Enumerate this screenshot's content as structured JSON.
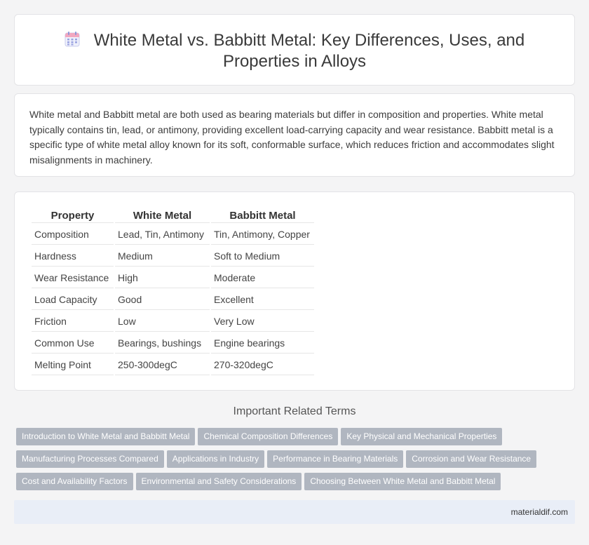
{
  "header": {
    "title_line1": "White Metal vs. Babbitt Metal: Key Differences, Uses, and",
    "title_line2": "Properties in Alloys",
    "icon": "calendar-icon"
  },
  "intro": {
    "text": "White metal and Babbitt metal are both used as bearing materials but differ in composition and properties. White metal typically contains tin, lead, or antimony, providing excellent load-carrying capacity and wear resistance. Babbitt metal is a specific type of white metal alloy known for its soft, conformable surface, which reduces friction and accommodates slight misalignments in machinery."
  },
  "table": {
    "headers": [
      "Property",
      "White Metal",
      "Babbitt Metal"
    ],
    "rows": [
      [
        "Composition",
        "Lead, Tin, Antimony",
        "Tin, Antimony, Copper"
      ],
      [
        "Hardness",
        "Medium",
        "Soft to Medium"
      ],
      [
        "Wear Resistance",
        "High",
        "Moderate"
      ],
      [
        "Load Capacity",
        "Good",
        "Excellent"
      ],
      [
        "Friction",
        "Low",
        "Very Low"
      ],
      [
        "Common Use",
        "Bearings, bushings",
        "Engine bearings"
      ],
      [
        "Melting Point",
        "250-300degC",
        "270-320degC"
      ]
    ]
  },
  "related": {
    "title": "Important Related Terms",
    "rows": [
      [
        "Introduction to White Metal and Babbitt Metal",
        "Chemical Composition Differences",
        "Key Physical and Mechanical Properties"
      ],
      [
        "Manufacturing Processes Compared",
        "Applications in Industry",
        "Performance in Bearing Materials",
        "Corrosion and Wear Resistance"
      ],
      [
        "Cost and Availability Factors",
        "Environmental and Safety Considerations",
        "Choosing Between White Metal and Babbitt Metal"
      ]
    ]
  },
  "footer": {
    "site": "materialdif.com"
  },
  "colors": {
    "tag_bg": "#b0b6c0",
    "footer_bg": "#e9eef7",
    "page_bg": "#f4f4f5"
  }
}
